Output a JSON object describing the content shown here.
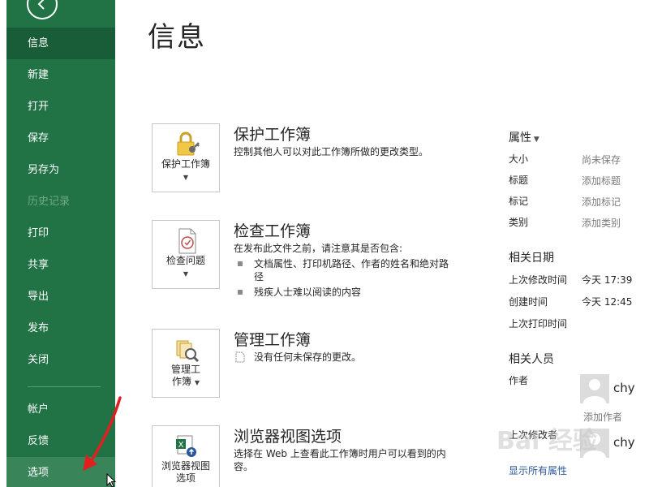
{
  "sidebar": {
    "items": [
      {
        "label": "信息"
      },
      {
        "label": "新建"
      },
      {
        "label": "打开"
      },
      {
        "label": "保存"
      },
      {
        "label": "另存为"
      },
      {
        "label": "历史记录"
      },
      {
        "label": "打印"
      },
      {
        "label": "共享"
      },
      {
        "label": "导出"
      },
      {
        "label": "发布"
      },
      {
        "label": "关闭"
      },
      {
        "label": "帐户"
      },
      {
        "label": "反馈"
      },
      {
        "label": "选项"
      }
    ],
    "active": "信息",
    "disabled": "历史记录",
    "colors": {
      "background": "#217346",
      "active": "#185d37"
    }
  },
  "main": {
    "title": "信息",
    "sections": [
      {
        "tile_label": "保护工作簿",
        "title": "保护工作簿",
        "description": "控制其他人可以对此工作簿所做的更改类型。"
      },
      {
        "tile_label": "检查问题",
        "title": "检查工作簿",
        "description": "在发布此文件之前，请注意其是否包含:",
        "bullets": [
          "文档属性、打印机路径、作者的姓名和绝对路径",
          "残疾人士难以阅读的内容"
        ]
      },
      {
        "tile_label_line1": "管理工",
        "tile_label_line2": "作簿",
        "title": "管理工作簿",
        "description": "没有任何未保存的更改。"
      },
      {
        "tile_label_line1": "浏览器视图",
        "tile_label_line2": "选项",
        "title": "浏览器视图选项",
        "description": "选择在 Web 上查看此工作簿时用户可以看到的内容。"
      }
    ]
  },
  "properties": {
    "heading": "属性",
    "rows": [
      {
        "label": "大小",
        "value": "尚未保存"
      },
      {
        "label": "标题",
        "value": "添加标题"
      },
      {
        "label": "标记",
        "value": "添加标记"
      },
      {
        "label": "类别",
        "value": "添加类别"
      }
    ],
    "dates_heading": "相关日期",
    "dates": [
      {
        "label": "上次修改时间",
        "value": "今天 17:39"
      },
      {
        "label": "创建时间",
        "value": "今天 12:45"
      },
      {
        "label": "上次打印时间",
        "value": ""
      }
    ],
    "people_heading": "相关人员",
    "author_label": "作者",
    "author_name": "chy",
    "add_author": "添加作者",
    "last_modified_by_label": "上次修改者",
    "last_modified_by_name": "chy",
    "show_all": "显示所有属性"
  },
  "watermark": {
    "text": "Bai 经验"
  },
  "icons": [
    "back-arrow-icon",
    "lock-key-icon",
    "inspect-document-icon",
    "manage-workbook-icon",
    "browser-view-icon",
    "file-check-icon",
    "user-avatar-icon"
  ]
}
